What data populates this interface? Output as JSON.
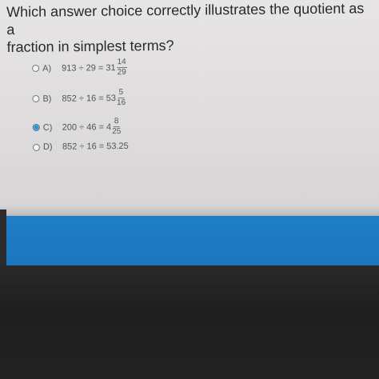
{
  "question": {
    "line1": "Which answer choice correctly illustrates the quotient as a",
    "line2": "fraction in simplest terms?"
  },
  "choices": [
    {
      "letter": "A)",
      "expr": "913 ÷ 29 = 31",
      "frac_num": "14",
      "frac_den": "29",
      "selected": false
    },
    {
      "letter": "B)",
      "expr": "852 ÷ 16 = 53",
      "frac_num": "5",
      "frac_den": "16",
      "selected": false
    },
    {
      "letter": "C)",
      "expr": "200 ÷ 46 = 4",
      "frac_num": "8",
      "frac_den": "25",
      "selected": true
    },
    {
      "letter": "D)",
      "expr": "852 ÷ 16 = 53.25",
      "frac_num": "",
      "frac_den": "",
      "selected": false
    }
  ],
  "colors": {
    "panel_bg": "#e2e0e1",
    "accent_bar": "#1f7ec7",
    "selected_radio": "#2d8fd0"
  }
}
